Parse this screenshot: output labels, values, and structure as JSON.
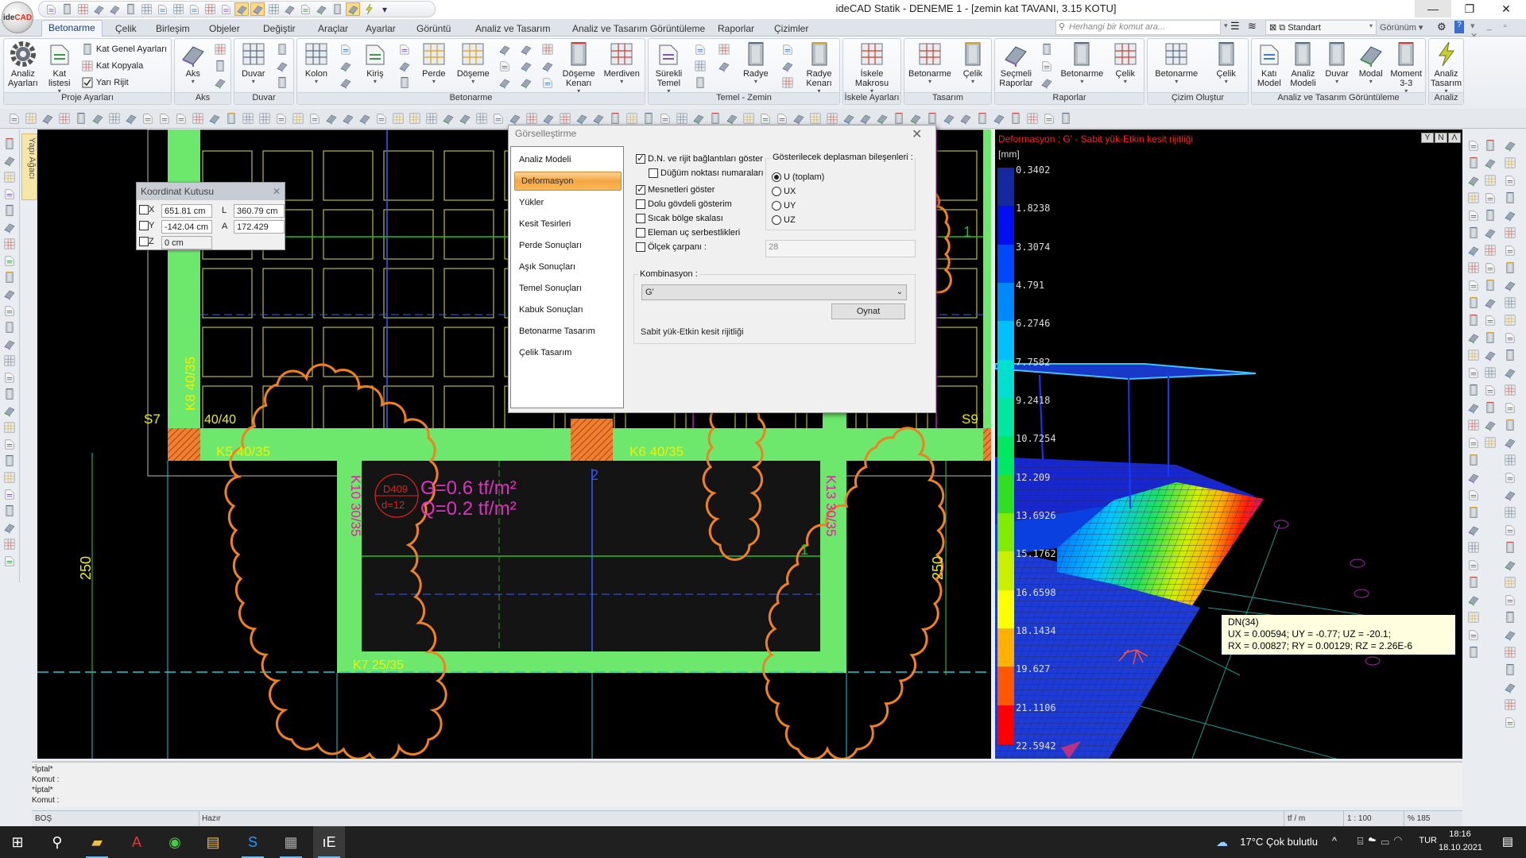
{
  "window": {
    "title": "ideCAD Statik - DENEME 1 - [zemin kat TAVANI,  3.15 KOTU]",
    "logo_text_a": "ide",
    "logo_text_b": "CAD",
    "controls": [
      "minimize-icon",
      "restore-icon",
      "close-icon"
    ]
  },
  "quick_access": [
    "home",
    "new",
    "open",
    "save",
    "save-all",
    "undo",
    "redo",
    "refresh",
    "layer-list",
    "cursor-select",
    "perpendicular",
    "parallel",
    "corner",
    "grid-snap",
    "snap-object",
    "snap-active",
    "snap-line",
    "snap-point",
    "ortho",
    "text-style",
    "lightning",
    "dropdown"
  ],
  "tabs": [
    "Betonarme",
    "Çelik",
    "Birleşim",
    "Objeler",
    "Değiştir",
    "Araçlar",
    "Ayarlar",
    "Görüntü",
    "Analiz ve Tasarım",
    "Analiz ve Tasarım Görüntüleme",
    "Raporlar",
    "Çizimler"
  ],
  "active_tab": 0,
  "search": {
    "placeholder": "Herhangi bir komut ara..."
  },
  "style_select": {
    "value": "Standart"
  },
  "view_menu": {
    "label": "Görünüm"
  },
  "ribbon": [
    {
      "label": "Proje Ayarları",
      "items": [
        {
          "type": "large",
          "label": "Analiz Ayarları",
          "icon": "gear",
          "dd": false
        },
        {
          "type": "large",
          "label": "Kat listesi",
          "icon": "floor-list",
          "dd": true
        },
        {
          "type": "col",
          "items": [
            {
              "label": "Kat Genel Ayarları",
              "icon": "floor-settings"
            },
            {
              "label": "Kat Kopyala",
              "icon": "floor-copy"
            },
            {
              "label": "Yarı Rijit",
              "icon": "checkbox-checked"
            }
          ]
        }
      ]
    },
    {
      "label": "Aks",
      "items": [
        {
          "type": "large",
          "label": "Aks",
          "icon": "axis",
          "dd": true
        },
        {
          "type": "col",
          "items": [
            {
              "icon": "axis-arc"
            },
            {
              "icon": "axis-circle"
            },
            {
              "icon": "axis-diagonal"
            }
          ]
        }
      ]
    },
    {
      "label": "Duvar",
      "items": [
        {
          "type": "large",
          "label": "Duvar",
          "icon": "wall",
          "dd": true
        },
        {
          "type": "col",
          "items": [
            {
              "icon": "wall-corner"
            },
            {
              "icon": "wall-opening"
            },
            {
              "icon": "wall-curve"
            }
          ]
        }
      ]
    },
    {
      "label": "Betonarme",
      "items": [
        {
          "type": "large",
          "label": "Kolon",
          "icon": "column",
          "dd": true
        },
        {
          "type": "col",
          "items": [
            {
              "icon": "column-round"
            },
            {
              "icon": "column-l"
            },
            {
              "icon": "column-capital"
            }
          ]
        },
        {
          "type": "large",
          "label": "Kiriş",
          "icon": "beam",
          "dd": true
        },
        {
          "type": "col",
          "items": [
            {
              "icon": "beam-corner"
            },
            {
              "icon": "beam-curve"
            },
            {
              "icon": "beam-arc"
            }
          ]
        },
        {
          "type": "large",
          "label": "Perde",
          "icon": "shear-wall",
          "dd": true
        },
        {
          "type": "large",
          "label": "Döşeme",
          "icon": "slab",
          "dd": true
        },
        {
          "type": "col",
          "items": [
            {
              "icon": "slab-ribbed"
            },
            {
              "icon": "slab-split"
            },
            {
              "icon": "slab-opening"
            }
          ]
        },
        {
          "type": "col",
          "items": [
            {
              "icon": "slab-hatch"
            },
            {
              "icon": "slab-grid"
            },
            {
              "icon": "slab-layers"
            }
          ]
        },
        {
          "type": "col",
          "items": [
            {
              "icon": "slab-joist"
            },
            {
              "icon": "slab-load"
            },
            {
              "icon": "slab-edge-l"
            }
          ]
        },
        {
          "type": "large",
          "label": "Döşeme Kenarı",
          "icon": "slab-edge",
          "dd": true
        },
        {
          "type": "large",
          "label": "Merdiven",
          "icon": "stairs",
          "dd": true
        }
      ]
    },
    {
      "label": "Temel - Zemin",
      "items": [
        {
          "type": "large",
          "label": "Sürekli Temel",
          "icon": "strip-footing",
          "dd": true
        },
        {
          "type": "col",
          "items": [
            {
              "icon": "single-footing"
            },
            {
              "icon": "pile"
            },
            {
              "icon": "tie-beam"
            }
          ]
        },
        {
          "type": "col",
          "items": [
            {
              "icon": "footing-corner"
            },
            {
              "icon": "footing-step"
            }
          ]
        },
        {
          "type": "large",
          "label": "Radye",
          "icon": "mat-foundation",
          "dd": true
        },
        {
          "type": "col",
          "items": [
            {
              "icon": "mat-column"
            },
            {
              "icon": "mat-split"
            },
            {
              "icon": "mat-edge"
            }
          ]
        },
        {
          "type": "large",
          "label": "Radye Kenarı",
          "icon": "mat-edge-3d",
          "dd": true
        }
      ]
    },
    {
      "label": "İskele Ayarları",
      "items": [
        {
          "type": "large",
          "label": "İskele Makrosu",
          "icon": "scaffold",
          "dd": true
        }
      ]
    },
    {
      "label": "Tasarım",
      "items": [
        {
          "type": "large",
          "label": "Betonarme",
          "icon": "rc-design",
          "dd": true
        },
        {
          "type": "large",
          "label": "Çelik",
          "icon": "steel-design",
          "dd": true
        }
      ]
    },
    {
      "label": "Raporlar",
      "items": [
        {
          "type": "large",
          "label": "Seçmeli Raporlar",
          "icon": "report-select",
          "dd": false
        },
        {
          "type": "col",
          "items": [
            {
              "icon": "report-add"
            },
            {
              "icon": "report-edit"
            },
            {
              "icon": "report-pdf"
            }
          ]
        },
        {
          "type": "large",
          "label": "Betonarme",
          "icon": "rc-report",
          "dd": true
        },
        {
          "type": "large",
          "label": "Çelik",
          "icon": "steel-report",
          "dd": true
        }
      ]
    },
    {
      "label": "Çizim Oluştur",
      "items": [
        {
          "type": "large",
          "label": "Betonarme",
          "icon": "rc-drawing",
          "dd": true
        },
        {
          "type": "large",
          "label": "Çelik",
          "icon": "steel-drawing",
          "dd": true
        }
      ]
    },
    {
      "label": "Analiz ve Tasarım Görüntüleme",
      "items": [
        {
          "type": "large",
          "label": "Katı Model",
          "icon": "solid-model",
          "dd": false
        },
        {
          "type": "large",
          "label": "Analiz Modeli",
          "icon": "analysis-model",
          "dd": false
        },
        {
          "type": "large",
          "label": "Duvar",
          "icon": "wall-view",
          "dd": true
        },
        {
          "type": "large",
          "label": "Modal",
          "icon": "modal",
          "dd": true
        },
        {
          "type": "large",
          "label": "Moment 3-3",
          "icon": "moment",
          "dd": true
        }
      ]
    },
    {
      "label": "Analiz",
      "items": [
        {
          "type": "large",
          "label": "Analiz Tasarım",
          "icon": "lightning",
          "dd": true
        }
      ]
    }
  ],
  "toolbar_icons": [
    "zoom-in",
    "zoom-window",
    "pencil",
    "brush",
    "eraser",
    "text",
    "dimension",
    "pan",
    "rotate-view",
    "refresh",
    "redraw",
    "ruler",
    "layer",
    "hatch",
    "trim",
    "extend",
    "offset",
    "split",
    "mirror",
    "array",
    "copy",
    "move",
    "rotate",
    "scale",
    "fillet",
    "chamfer",
    "stretch",
    "explode",
    "join",
    "break",
    "align",
    "measure",
    "area",
    "grid",
    "block",
    "insert",
    "circle",
    "arc",
    "polyline",
    "rectangle",
    "ellipse",
    "spline",
    "point",
    "leader",
    "table",
    "revision-cloud",
    "image",
    "camera",
    "render",
    "light",
    "section",
    "elevation",
    "detail",
    "symbol",
    "north",
    "level",
    "elevation-mark",
    "print",
    "export",
    "shade",
    "wireframe",
    "hidden",
    "color",
    "highlight"
  ],
  "yapi_agaci": "Yapı Ağacı",
  "coord_box": {
    "title": "Koordinat Kutusu",
    "x_label": "X",
    "x_value": "651.81 cm",
    "y_label": "Y",
    "y_value": "-142.04 cm",
    "z_label": "Z",
    "z_value": "0 cm",
    "l_label": "L",
    "l_value": "360.79 cm",
    "a_label": "A",
    "a_value": "172.429"
  },
  "plan": {
    "s7": "S7",
    "s9": "S9",
    "col_size": "40/40",
    "k8": "K8 40/35",
    "k5": "K5 40/35",
    "k6": "K6 40/35",
    "k10": "K10 30/35",
    "k13": "K13 30/35",
    "k7": "K7 25/35",
    "slab_id": "D409",
    "slab_thk": "d=12",
    "load_g": "G=0.6 tf/m²",
    "load_q": "Q=0.2 tf/m²",
    "dim_left": "250",
    "dim_right": "250",
    "axis_1a": "1",
    "axis_1b": "1",
    "axis_2": "2"
  },
  "dialog": {
    "title": "Görselleştirme",
    "nav": [
      "Analiz Modeli",
      "Deformasyon",
      "Yükler",
      "Kesit Tesirleri",
      "Perde Sonuçları",
      "Aşık Sonuçları",
      "Temel Sonuçları",
      "Kabuk Sonuçları",
      "Betonarme Tasarım",
      "Çelik Tasarım"
    ],
    "nav_selected": 1,
    "options": [
      {
        "label": "D.N. ve rijit bağlantıları göster",
        "checked": true
      },
      {
        "label": "Düğüm noktası numaraları",
        "checked": false
      },
      {
        "label": "Mesnetleri göster",
        "checked": true
      },
      {
        "label": "Dolu gövdeli gösterim",
        "checked": false
      },
      {
        "label": "Sıcak bölge skalası",
        "checked": false
      },
      {
        "label": "Eleman uç serbestlikleri",
        "checked": false
      },
      {
        "label": "Ölçek çarpanı :",
        "checked": false
      }
    ],
    "scale_value": "28",
    "components_title": "Gösterilecek deplasman bileşenleri :",
    "components": [
      {
        "label": "U (toplam)",
        "selected": true
      },
      {
        "label": "UX",
        "selected": false
      },
      {
        "label": "UY",
        "selected": false
      },
      {
        "label": "UZ",
        "selected": false
      }
    ],
    "combination_title": "Kombinasyon :",
    "combination_value": "G'",
    "play_button": "Oynat",
    "description": "Sabit yük-Etkin kesit rijitliği"
  },
  "view3d": {
    "title": "Deformasyon : G'  -  Sabit yük-Etkin kesit rijitliği",
    "unit": "[mm]",
    "view_buttons": [
      "Y",
      "N",
      "Λ"
    ],
    "legend_values": [
      "0.3402",
      "1.8238",
      "3.3074",
      "4.791",
      "6.2746",
      "7.7582",
      "9.2418",
      "10.7254",
      "12.209",
      "13.6926",
      "15.1762",
      "16.6598",
      "18.1434",
      "19.627",
      "21.1106",
      "22.5942"
    ],
    "legend_colors": [
      "#1428a0",
      "#0010f0",
      "#0048ff",
      "#0088ff",
      "#00c0ff",
      "#00e0d0",
      "#00e8a0",
      "#00e860",
      "#30e020",
      "#80ec00",
      "#c8f000",
      "#ffff00",
      "#ffb000",
      "#ff5800",
      "#ff0000",
      "#e01070"
    ],
    "tooltip": {
      "line1": "DN(34)",
      "line2": "UX = 0.00594; UY = -0.77; UZ = -20.1;",
      "line3": "RX = 0.00827; RY = 0.00129; RZ = 2.26E-6"
    }
  },
  "command_lines": [
    "*İptal*",
    "Komut :",
    "*İptal*",
    "Komut :"
  ],
  "status": {
    "left": "BOŞ",
    "message": "Hazır",
    "unit": "tf / m",
    "scale": "1 : 100",
    "zoom": "% 185"
  },
  "taskbar": {
    "apps": [
      "start",
      "search",
      "file-explorer",
      "acrobat",
      "chrome",
      "notes-app",
      "skype",
      "calculator",
      "idecad"
    ],
    "weather": "17°C  Çok bulutlu",
    "language": "TUR",
    "time": "18:16",
    "date": "18.10.2021"
  }
}
